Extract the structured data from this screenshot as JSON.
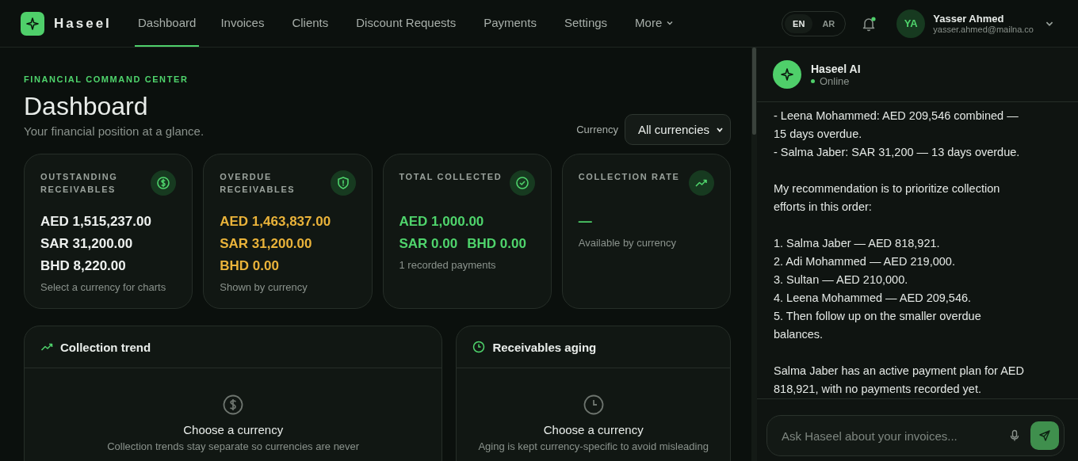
{
  "brand": {
    "name": "Haseel"
  },
  "nav": [
    {
      "label": "Dashboard",
      "selected": true,
      "kind": "link"
    },
    {
      "label": "Invoices",
      "selected": false,
      "kind": "link"
    },
    {
      "label": "Clients",
      "selected": false,
      "kind": "link"
    },
    {
      "label": "Discount Requests",
      "selected": false,
      "kind": "link"
    },
    {
      "label": "Payments",
      "selected": false,
      "kind": "link"
    },
    {
      "label": "Settings",
      "selected": false,
      "kind": "link"
    },
    {
      "label": "More",
      "selected": false,
      "kind": "dropdown"
    }
  ],
  "languages": [
    {
      "label": "EN",
      "selected": true
    },
    {
      "label": "AR",
      "selected": false
    }
  ],
  "notifications": {
    "unread": true
  },
  "user": {
    "initials": "YA",
    "name": "Yasser Ahmed",
    "email": "yasser.ahmed@mailna.co"
  },
  "page": {
    "eyebrow": "FINANCIAL COMMAND CENTER",
    "title": "Dashboard",
    "subtitle": "Your financial position at a glance.",
    "currency_label": "Currency",
    "currency_value": "All currencies"
  },
  "stats": [
    {
      "label": "OUTSTANDING RECEIVABLES",
      "kind": "outstanding",
      "rows": [
        [
          "AED 1,515,237.00"
        ],
        [
          "SAR 31,200.00"
        ],
        [
          "BHD 8,220.00"
        ]
      ],
      "note": "Select a currency for charts"
    },
    {
      "label": "OVERDUE RECEIVABLES",
      "kind": "overdue",
      "rows": [
        [
          "AED 1,463,837.00"
        ],
        [
          "SAR 31,200.00"
        ],
        [
          "BHD 0.00"
        ]
      ],
      "note": "Shown by currency"
    },
    {
      "label": "TOTAL COLLECTED",
      "kind": "collected",
      "rows": [
        [
          "AED 1,000.00"
        ],
        [
          "SAR 0.00",
          "BHD 0.00"
        ]
      ],
      "note": "1 recorded payments"
    },
    {
      "label": "COLLECTION RATE",
      "kind": "rate",
      "rows": [
        [
          "—"
        ]
      ],
      "note": "Available by currency"
    }
  ],
  "panels": [
    {
      "title": "Collection trend",
      "empty_title": "Choose a currency",
      "empty_text": "Collection trends stay separate so currencies are never"
    },
    {
      "title": "Receivables aging",
      "empty_title": "Choose a currency",
      "empty_text": "Aging is kept currency-specific to avoid misleading"
    }
  ],
  "chat": {
    "title": "Haseel AI",
    "status": "Online",
    "online": true,
    "paragraphs": [
      {
        "lines": [
          "- Leena Mohammed: AED 209,546 combined — 15 days overdue.",
          "- Salma Jaber: SAR 31,200 — 13 days overdue."
        ]
      },
      {
        "lines": [
          "My recommendation is to prioritize collection efforts in this order:"
        ]
      },
      {
        "lines": [
          "1. Salma Jaber — AED 818,921.",
          "2. Adi Mohammed — AED 219,000.",
          "3. Sultan — AED 210,000.",
          "4. Leena Mohammed — AED 209,546.",
          "5. Then follow up on the smaller overdue balances."
        ]
      },
      {
        "lines": [
          "Salma Jaber has an active payment plan for AED 818,921, with no payments recorded yet."
        ]
      }
    ],
    "placeholder": "Ask Haseel about your invoices..."
  }
}
